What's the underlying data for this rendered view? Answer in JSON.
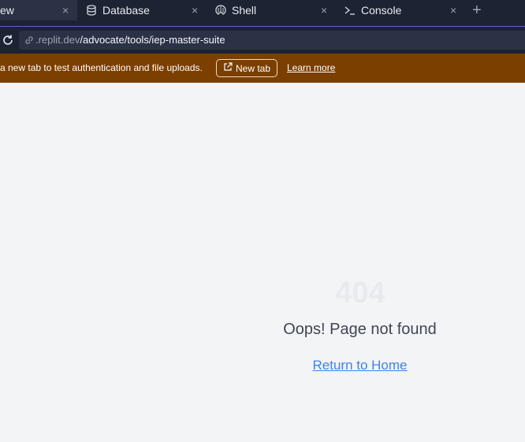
{
  "tabs": [
    {
      "label": "ew",
      "active": true
    },
    {
      "label": "Database",
      "icon": "database-icon"
    },
    {
      "label": "Shell",
      "icon": "shell-icon"
    },
    {
      "label": "Console",
      "icon": "terminal-icon"
    }
  ],
  "close_glyph": "×",
  "new_tab_glyph": "+",
  "url": {
    "domain": ".replit.dev",
    "path": "/advocate/tools/iep-master-suite"
  },
  "banner": {
    "message": "a new tab to test authentication and file uploads.",
    "new_tab_label": "New tab",
    "learn_more_label": "Learn more"
  },
  "page": {
    "code": "404",
    "heading": "Oops! Page not found",
    "home_link": "Return to Home"
  },
  "colors": {
    "tabbar_bg": "#1c2333",
    "banner_bg": "#7b3f00",
    "link": "#3b82f6"
  }
}
